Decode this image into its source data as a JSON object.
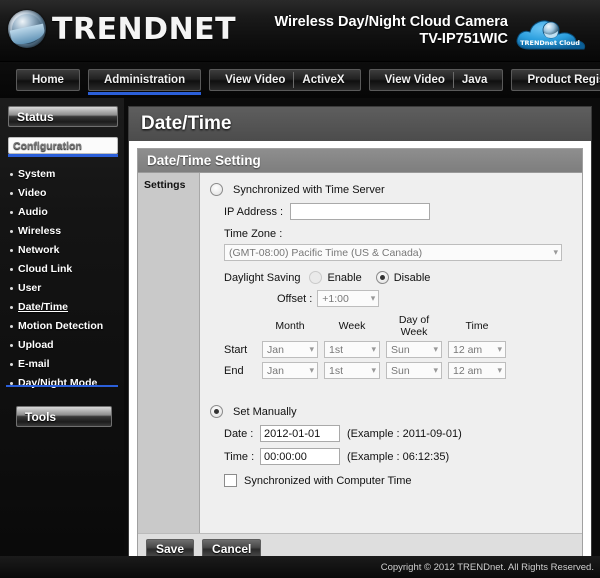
{
  "header": {
    "brand": "TRENDNET",
    "logo_icon": "trendnet-globe-logo",
    "product_line1": "Wireless Day/Night Cloud Camera",
    "product_line2": "TV-IP751WIC",
    "cloud_badge_label": "TRENDnet Cloud",
    "cloud_badge_icon": "cloud-icon",
    "accent_color": "#2b5fd9"
  },
  "nav": {
    "items": [
      {
        "label": "Home",
        "active": false,
        "segments": [
          "Home"
        ]
      },
      {
        "label": "Administration",
        "active": true,
        "segments": [
          "Administration"
        ]
      },
      {
        "label": "View Video ActiveX",
        "active": false,
        "segments": [
          "View Video",
          "ActiveX"
        ]
      },
      {
        "label": "View Video Java",
        "active": false,
        "segments": [
          "View Video",
          "Java"
        ]
      },
      {
        "label": "Product Registration",
        "active": false,
        "segments": [
          "Product Registration"
        ]
      }
    ]
  },
  "sidebar": {
    "status_label": "Status",
    "configuration_label": "Configuration",
    "tools_label": "Tools",
    "items": [
      {
        "label": "System",
        "current": false
      },
      {
        "label": "Video",
        "current": false
      },
      {
        "label": "Audio",
        "current": false
      },
      {
        "label": "Wireless",
        "current": false
      },
      {
        "label": "Network",
        "current": false
      },
      {
        "label": "Cloud Link",
        "current": false
      },
      {
        "label": "User",
        "current": false
      },
      {
        "label": "Date/Time",
        "current": true
      },
      {
        "label": "Motion Detection",
        "current": false
      },
      {
        "label": "Upload",
        "current": false
      },
      {
        "label": "E-mail",
        "current": false
      },
      {
        "label": "Day/Night Mode",
        "current": false
      }
    ]
  },
  "page": {
    "title": "Date/Time",
    "panel_title": "Date/Time Setting",
    "settings_label": "Settings"
  },
  "form": {
    "sync_server": {
      "radio_label": "Synchronized with Time Server",
      "selected": false,
      "ip_label": "IP Address  :",
      "ip_value": "",
      "ip_placeholder": "",
      "timezone_label": "Time Zone  :",
      "timezone_value": "(GMT-08:00) Pacific Time (US & Canada)"
    },
    "daylight": {
      "label": "Daylight Saving",
      "enable_label": "Enable",
      "disable_label": "Disable",
      "selected": "Disable",
      "offset_label": "Offset :",
      "offset_value": "+1:00",
      "col_month": "Month",
      "col_week": "Week",
      "col_day": "Day of Week",
      "col_time": "Time",
      "rows": [
        {
          "name": "Start",
          "month": "Jan",
          "week": "1st",
          "day": "Sun",
          "time": "12 am"
        },
        {
          "name": "End",
          "month": "Jan",
          "week": "1st",
          "day": "Sun",
          "time": "12 am"
        }
      ]
    },
    "manual": {
      "radio_label": "Set Manually",
      "selected": true,
      "date_label": "Date  :",
      "date_value": "2012-01-01",
      "date_example": "(Example : 2011-09-01)",
      "time_label": "Time :",
      "time_value": "00:00:00",
      "time_example": "(Example : 06:12:35)",
      "sync_computer_label": "Synchronized with Computer Time",
      "sync_computer_checked": false
    }
  },
  "buttons": {
    "save": "Save",
    "cancel": "Cancel"
  },
  "footer": {
    "copyright": "Copyright © 2012 TRENDnet.  All Rights Reserved."
  }
}
